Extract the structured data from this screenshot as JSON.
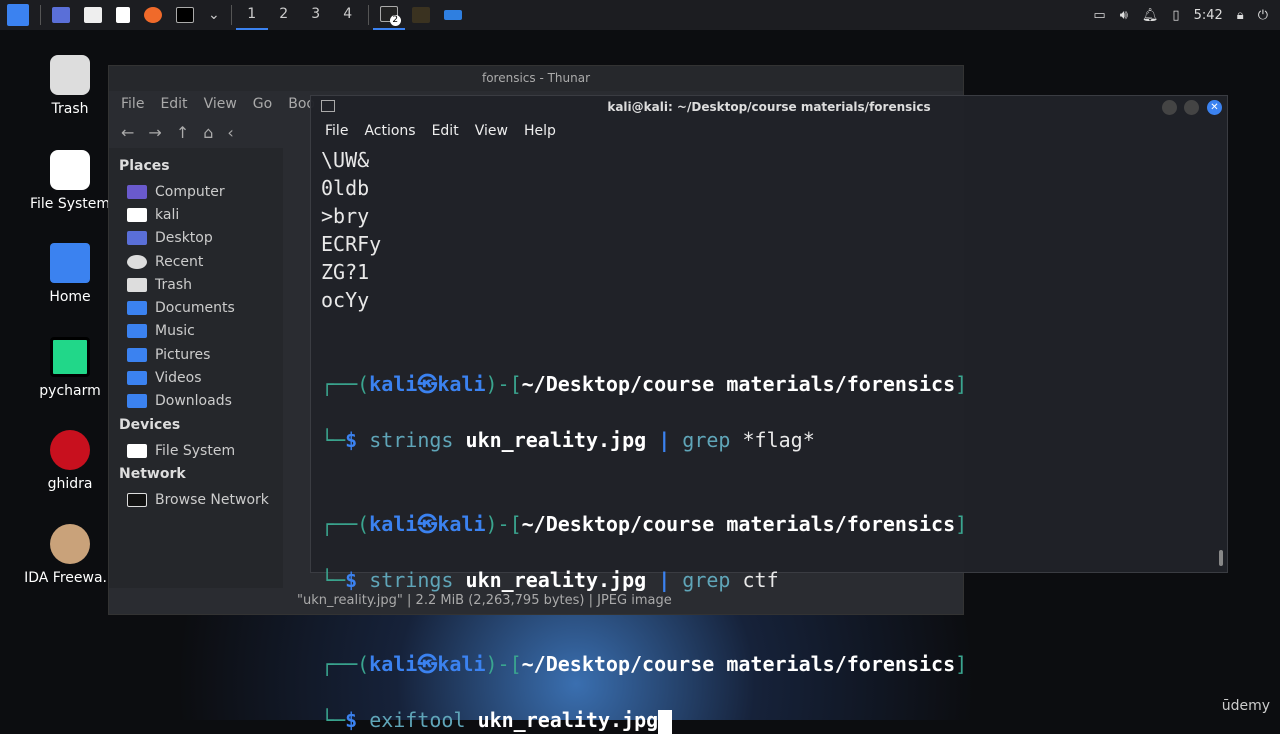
{
  "taskbar": {
    "workspaces": [
      "1",
      "2",
      "3",
      "4"
    ],
    "terminal_badge": "2",
    "clock": "5:42"
  },
  "desktop_icons": [
    "Trash",
    "File System",
    "Home",
    "pycharm",
    "ghidra",
    "IDA Freewa..."
  ],
  "thunar": {
    "title": "forensics - Thunar",
    "menu": [
      "File",
      "Edit",
      "View",
      "Go",
      "Boo"
    ],
    "sidebar": {
      "places_header": "Places",
      "places": [
        "Computer",
        "kali",
        "Desktop",
        "Recent",
        "Trash",
        "Documents",
        "Music",
        "Pictures",
        "Videos",
        "Downloads"
      ],
      "devices_header": "Devices",
      "devices": [
        "File System"
      ],
      "network_header": "Network",
      "network": [
        "Browse Network"
      ]
    },
    "status": "\"ukn_reality.jpg\" | 2.2 MiB (2,263,795 bytes) | JPEG image"
  },
  "terminal": {
    "title": "kali@kali: ~/Desktop/course materials/forensics",
    "menu": [
      "File",
      "Actions",
      "Edit",
      "View",
      "Help"
    ],
    "output": [
      "\\UW&",
      "0ldb",
      ">bry",
      "ECRFy",
      "ZG?1",
      "ocYy"
    ],
    "prompt": {
      "user": "kali",
      "host": "kali",
      "path": "~/Desktop/course materials/forensics"
    },
    "commands": [
      {
        "cmd": "strings",
        "arg": "ukn_reality.jpg",
        "pipe": "|",
        "cmd2": "grep",
        "arg2": "*flag*"
      },
      {
        "cmd": "strings",
        "arg": "ukn_reality.jpg",
        "pipe": "|",
        "cmd2": "grep",
        "arg2": "ctf"
      },
      {
        "cmd": "exiftool",
        "arg": "ukn_reality.jpg"
      }
    ]
  },
  "watermark": "ūdemy"
}
